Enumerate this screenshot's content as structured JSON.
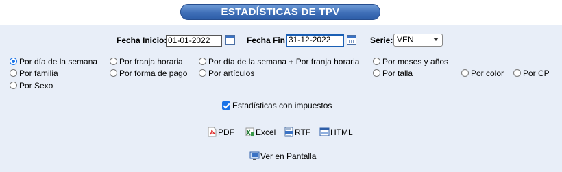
{
  "title": "ESTADÍSTICAS DE TPV",
  "filters": {
    "fecha_inicio_label": "Fecha Inicio:",
    "fecha_inicio_value": "01-01-2022",
    "fecha_fin_label": "Fecha Fin:",
    "fecha_fin_value": "31-12-2022",
    "serie_label": "Serie:",
    "serie_value": "VEN"
  },
  "options": [
    {
      "label": "Por día de la semana",
      "checked": true
    },
    {
      "label": "Por franja horaria",
      "checked": false
    },
    {
      "label": "Por día de la semana + Por franja horaria",
      "checked": false
    },
    {
      "label": "Por meses y años",
      "checked": false
    },
    {
      "label": "Por familia",
      "checked": false
    },
    {
      "label": "Por forma de pago",
      "checked": false
    },
    {
      "label": "Por artículos",
      "checked": false
    },
    {
      "label": "Por talla",
      "checked": false
    },
    {
      "label": "Por color",
      "checked": false
    },
    {
      "label": "Por CP",
      "checked": false
    },
    {
      "label": "Por Sexo",
      "checked": false
    }
  ],
  "tax_checkbox": {
    "label": "Estadísticas con impuestos",
    "checked": true
  },
  "exports": {
    "pdf": "PDF",
    "excel": "Excel",
    "rtf": "RTF",
    "html": "HTML"
  },
  "screen_link": "Ver en Pantalla",
  "icons": {
    "calendar": "calendar-icon",
    "pdf": "pdf-icon",
    "excel": "excel-icon",
    "rtf": "rtf-icon",
    "html": "html-icon",
    "monitor": "monitor-icon"
  },
  "colors": {
    "accent": "#1a73e8",
    "title_bar": "#3f6fb8",
    "panel_bg": "#e8eef8"
  }
}
